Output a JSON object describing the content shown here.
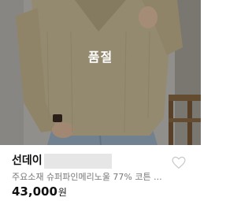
{
  "product": {
    "sold_out_label": "품절",
    "shop_name": "선데이",
    "title": "주요소재 슈퍼파인메리노울 77% 코튼 ...",
    "price": "43,000",
    "currency": "원",
    "wishlist_icon": "heart-outline-icon"
  },
  "colors": {
    "overlay": "#000000",
    "sweater": "#cdbf9a",
    "jeans": "#9db3c6",
    "text_muted": "#777777",
    "text_main": "#111111"
  }
}
